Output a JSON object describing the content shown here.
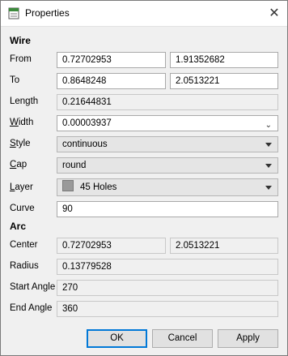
{
  "window": {
    "title": "Properties",
    "close_glyph": "✕"
  },
  "wire": {
    "header": "Wire",
    "from": {
      "label": "From",
      "x": "0.72702953",
      "y": "1.91352682"
    },
    "to": {
      "label": "To",
      "x": "0.8648248",
      "y": "2.0513221"
    },
    "length": {
      "label": "Length",
      "value": "0.21644831"
    },
    "width": {
      "label_accel": "W",
      "label_rest": "idth",
      "value": "0.00003937"
    },
    "style": {
      "label_accel": "S",
      "label_rest": "tyle",
      "value": "continuous"
    },
    "cap": {
      "label_accel": "C",
      "label_rest": "ap",
      "value": "round"
    },
    "layer": {
      "label_accel": "L",
      "label_rest": "ayer",
      "value": "45 Holes",
      "swatch_color": "#999999"
    },
    "curve": {
      "label": "Curve",
      "value": "90"
    }
  },
  "arc": {
    "header": "Arc",
    "center": {
      "label": "Center",
      "x": "0.72702953",
      "y": "2.0513221"
    },
    "radius": {
      "label": "Radius",
      "value": "0.13779528"
    },
    "start_angle": {
      "label": "Start Angle",
      "value": "270"
    },
    "end_angle": {
      "label": "End Angle",
      "value": "360"
    }
  },
  "buttons": {
    "ok": "OK",
    "cancel": "Cancel",
    "apply": "Apply"
  }
}
